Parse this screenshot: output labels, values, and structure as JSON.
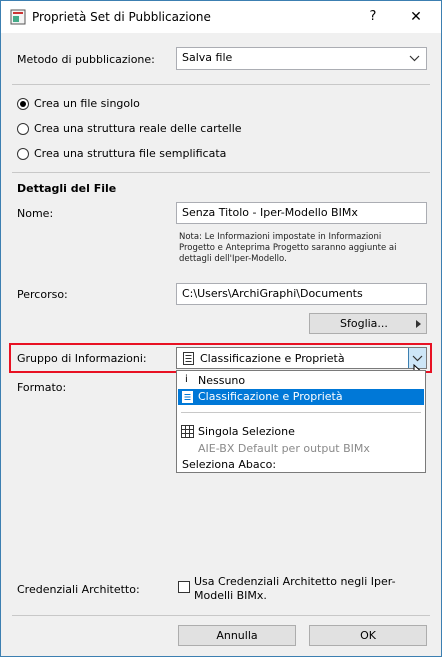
{
  "window": {
    "title": "Proprietà Set di Pubblicazione",
    "help_label": "?",
    "close_label": "✕"
  },
  "publish_method": {
    "label": "Metodo di pubblicazione:",
    "value": "Salva file"
  },
  "options": {
    "single_file": "Crea un file singolo",
    "real_structure": "Crea una struttura reale delle cartelle",
    "simplified_structure": "Crea una struttura file semplificata"
  },
  "file_details": {
    "heading": "Dettagli del File",
    "name_label": "Nome:",
    "name_value": "Senza Titolo - Iper-Modello BIMx",
    "note": "Nota: Le Informazioni impostate in Informazioni Progetto e Anteprima Progetto saranno aggiunte ai dettagli dell'Iper-Modello.",
    "path_label": "Percorso:",
    "path_value": "C:\\Users\\ArchiGraphi\\Documents",
    "browse_label": "Sfoglia..."
  },
  "info_group": {
    "label": "Gruppo di Informazioni:",
    "value": "Classificazione e Proprietà"
  },
  "format_label": "Formato:",
  "dropdown": {
    "none": "Nessuno",
    "classification": "Classificazione e Proprietà",
    "single_selection": "Singola Selezione",
    "bimx_default": "AIE-BX Default per output BIMx",
    "select_schedule": "Seleziona Abaco:"
  },
  "credentials": {
    "label": "Credenziali Architetto:",
    "checkbox_text": "Usa Credenziali Architetto negli Iper-Modelli BIMx."
  },
  "buttons": {
    "cancel": "Annulla",
    "ok": "OK"
  }
}
